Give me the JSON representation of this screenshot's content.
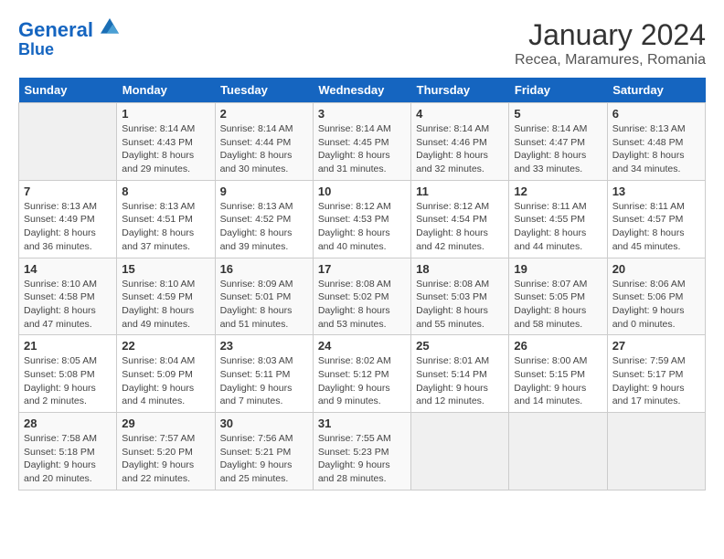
{
  "header": {
    "logo_line1": "General",
    "logo_line2": "Blue",
    "title": "January 2024",
    "subtitle": "Recea, Maramures, Romania"
  },
  "weekdays": [
    "Sunday",
    "Monday",
    "Tuesday",
    "Wednesday",
    "Thursday",
    "Friday",
    "Saturday"
  ],
  "weeks": [
    [
      {
        "num": "",
        "info": ""
      },
      {
        "num": "1",
        "info": "Sunrise: 8:14 AM\nSunset: 4:43 PM\nDaylight: 8 hours\nand 29 minutes."
      },
      {
        "num": "2",
        "info": "Sunrise: 8:14 AM\nSunset: 4:44 PM\nDaylight: 8 hours\nand 30 minutes."
      },
      {
        "num": "3",
        "info": "Sunrise: 8:14 AM\nSunset: 4:45 PM\nDaylight: 8 hours\nand 31 minutes."
      },
      {
        "num": "4",
        "info": "Sunrise: 8:14 AM\nSunset: 4:46 PM\nDaylight: 8 hours\nand 32 minutes."
      },
      {
        "num": "5",
        "info": "Sunrise: 8:14 AM\nSunset: 4:47 PM\nDaylight: 8 hours\nand 33 minutes."
      },
      {
        "num": "6",
        "info": "Sunrise: 8:13 AM\nSunset: 4:48 PM\nDaylight: 8 hours\nand 34 minutes."
      }
    ],
    [
      {
        "num": "7",
        "info": "Sunrise: 8:13 AM\nSunset: 4:49 PM\nDaylight: 8 hours\nand 36 minutes."
      },
      {
        "num": "8",
        "info": "Sunrise: 8:13 AM\nSunset: 4:51 PM\nDaylight: 8 hours\nand 37 minutes."
      },
      {
        "num": "9",
        "info": "Sunrise: 8:13 AM\nSunset: 4:52 PM\nDaylight: 8 hours\nand 39 minutes."
      },
      {
        "num": "10",
        "info": "Sunrise: 8:12 AM\nSunset: 4:53 PM\nDaylight: 8 hours\nand 40 minutes."
      },
      {
        "num": "11",
        "info": "Sunrise: 8:12 AM\nSunset: 4:54 PM\nDaylight: 8 hours\nand 42 minutes."
      },
      {
        "num": "12",
        "info": "Sunrise: 8:11 AM\nSunset: 4:55 PM\nDaylight: 8 hours\nand 44 minutes."
      },
      {
        "num": "13",
        "info": "Sunrise: 8:11 AM\nSunset: 4:57 PM\nDaylight: 8 hours\nand 45 minutes."
      }
    ],
    [
      {
        "num": "14",
        "info": "Sunrise: 8:10 AM\nSunset: 4:58 PM\nDaylight: 8 hours\nand 47 minutes."
      },
      {
        "num": "15",
        "info": "Sunrise: 8:10 AM\nSunset: 4:59 PM\nDaylight: 8 hours\nand 49 minutes."
      },
      {
        "num": "16",
        "info": "Sunrise: 8:09 AM\nSunset: 5:01 PM\nDaylight: 8 hours\nand 51 minutes."
      },
      {
        "num": "17",
        "info": "Sunrise: 8:08 AM\nSunset: 5:02 PM\nDaylight: 8 hours\nand 53 minutes."
      },
      {
        "num": "18",
        "info": "Sunrise: 8:08 AM\nSunset: 5:03 PM\nDaylight: 8 hours\nand 55 minutes."
      },
      {
        "num": "19",
        "info": "Sunrise: 8:07 AM\nSunset: 5:05 PM\nDaylight: 8 hours\nand 58 minutes."
      },
      {
        "num": "20",
        "info": "Sunrise: 8:06 AM\nSunset: 5:06 PM\nDaylight: 9 hours\nand 0 minutes."
      }
    ],
    [
      {
        "num": "21",
        "info": "Sunrise: 8:05 AM\nSunset: 5:08 PM\nDaylight: 9 hours\nand 2 minutes."
      },
      {
        "num": "22",
        "info": "Sunrise: 8:04 AM\nSunset: 5:09 PM\nDaylight: 9 hours\nand 4 minutes."
      },
      {
        "num": "23",
        "info": "Sunrise: 8:03 AM\nSunset: 5:11 PM\nDaylight: 9 hours\nand 7 minutes."
      },
      {
        "num": "24",
        "info": "Sunrise: 8:02 AM\nSunset: 5:12 PM\nDaylight: 9 hours\nand 9 minutes."
      },
      {
        "num": "25",
        "info": "Sunrise: 8:01 AM\nSunset: 5:14 PM\nDaylight: 9 hours\nand 12 minutes."
      },
      {
        "num": "26",
        "info": "Sunrise: 8:00 AM\nSunset: 5:15 PM\nDaylight: 9 hours\nand 14 minutes."
      },
      {
        "num": "27",
        "info": "Sunrise: 7:59 AM\nSunset: 5:17 PM\nDaylight: 9 hours\nand 17 minutes."
      }
    ],
    [
      {
        "num": "28",
        "info": "Sunrise: 7:58 AM\nSunset: 5:18 PM\nDaylight: 9 hours\nand 20 minutes."
      },
      {
        "num": "29",
        "info": "Sunrise: 7:57 AM\nSunset: 5:20 PM\nDaylight: 9 hours\nand 22 minutes."
      },
      {
        "num": "30",
        "info": "Sunrise: 7:56 AM\nSunset: 5:21 PM\nDaylight: 9 hours\nand 25 minutes."
      },
      {
        "num": "31",
        "info": "Sunrise: 7:55 AM\nSunset: 5:23 PM\nDaylight: 9 hours\nand 28 minutes."
      },
      {
        "num": "",
        "info": ""
      },
      {
        "num": "",
        "info": ""
      },
      {
        "num": "",
        "info": ""
      }
    ]
  ]
}
